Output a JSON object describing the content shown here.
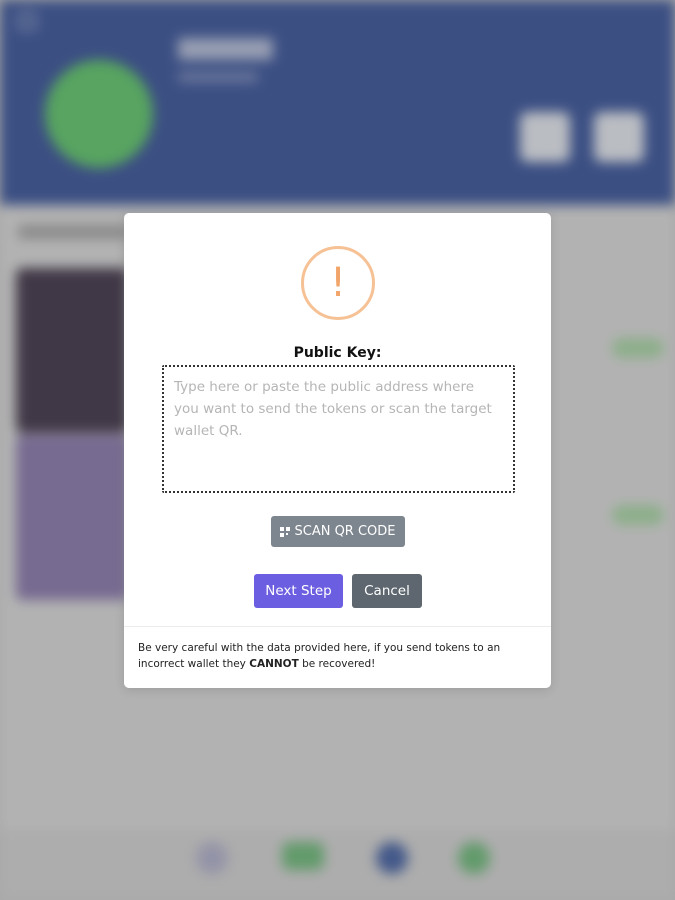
{
  "modal": {
    "icon": "exclamation-circle-icon",
    "icon_glyph": "!",
    "label": "Public Key:",
    "input_placeholder": "Type here or paste the public address where you want to send the tokens or scan the target wallet QR.",
    "input_value": "",
    "scan_button": {
      "icon": "qr-code-icon",
      "label": "SCAN QR CODE"
    },
    "next_button": "Next Step",
    "cancel_button": "Cancel",
    "warning": {
      "before": "Be very careful with the data provided here, if you send tokens to an incorrect wallet they ",
      "emphasis": "CANNOT",
      "after": " be recovered!"
    }
  },
  "colors": {
    "primary": "#6c5ee0",
    "secondary": "#5e6770",
    "scan_button": "#7d858e",
    "warning_icon": "#f2a56a",
    "background_header": "#22408f"
  }
}
